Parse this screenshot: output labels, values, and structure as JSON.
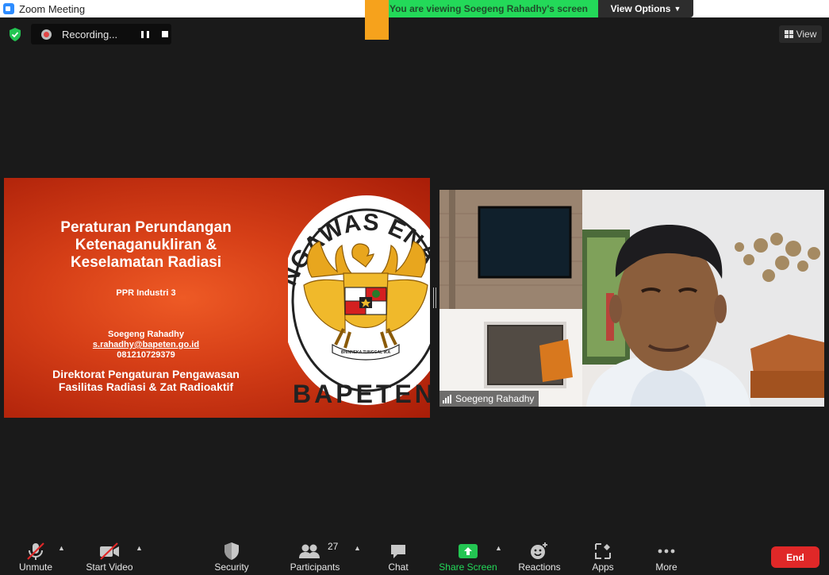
{
  "window": {
    "title": "Zoom Meeting"
  },
  "banner": {
    "viewing_text": "You are viewing Soegeng Rahadhy's screen",
    "view_options": "View Options"
  },
  "recording": {
    "label": "Recording..."
  },
  "view_button": {
    "label": "View"
  },
  "slide": {
    "title_lines": [
      "Peraturan Perundangan",
      "Ketenaganukliran &",
      "Keselamatan Radiasi"
    ],
    "subtitle": "PPR Industri 3",
    "author": "Soegeng Rahadhy",
    "email": "s.rahadhy@bapeten.go.id",
    "phone": "081210729379",
    "directorate_lines": [
      "Direktorat Pengaturan Pengawasan",
      "Fasilitas Radiasi & Zat Radioaktif"
    ],
    "logo_top_text": "NGAWAS ENA",
    "logo_bottom_text": "BAPETEN",
    "logo_motto": "BHINNEKA TUNGGAL IKA"
  },
  "video": {
    "participant_name": "Soegeng Rahadhy"
  },
  "toolbar": {
    "unmute": "Unmute",
    "start_video": "Start Video",
    "security": "Security",
    "participants": "Participants",
    "participants_count": "27",
    "chat": "Chat",
    "share_screen": "Share Screen",
    "reactions": "Reactions",
    "apps": "Apps",
    "more": "More",
    "end": "End"
  },
  "colors": {
    "share_green": "#23d959",
    "end_red": "#e02828",
    "slide_orange": "#e04a1c",
    "accent_orange": "#f6a21c"
  }
}
